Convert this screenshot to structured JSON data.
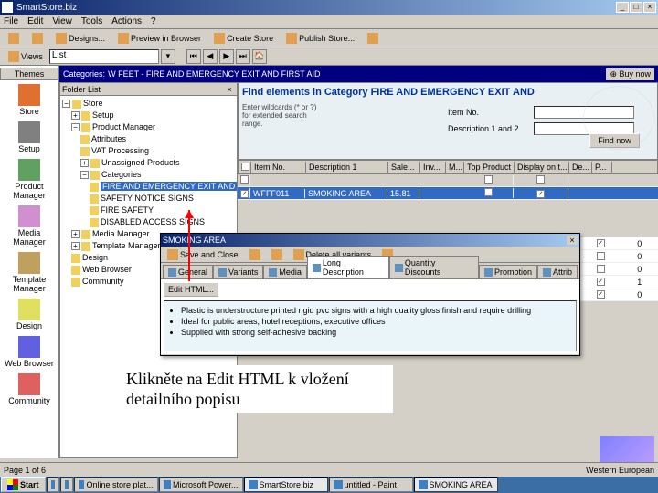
{
  "window": {
    "title": "SmartStore.biz"
  },
  "menu": {
    "file": "File",
    "edit": "Edit",
    "view": "View",
    "tools": "Tools",
    "actions": "Actions",
    "help": "?"
  },
  "toolbar1": {
    "designs": "Designs...",
    "preview": "Preview in Browser",
    "create": "Create Store",
    "publish": "Publish Store..."
  },
  "toolbar2": {
    "views": "Views",
    "dropdown": "List"
  },
  "sidebar": {
    "header": "Themes",
    "items": [
      {
        "label": "Store"
      },
      {
        "label": "Setup"
      },
      {
        "label": "Product Manager"
      },
      {
        "label": "Media Manager"
      },
      {
        "label": "Template Manager"
      },
      {
        "label": "Design"
      },
      {
        "label": "Web Browser"
      },
      {
        "label": "Community"
      }
    ]
  },
  "category": {
    "prefix": "Categories:",
    "name": "W FEET - FIRE AND EMERGENCY EXIT AND FIRST AID",
    "buy": "⊕ Buy now"
  },
  "folder": {
    "title": "Folder List",
    "root": "Store",
    "nodes": {
      "n1": "Setup",
      "n2": "Product Manager",
      "n3": "Attributes",
      "n4": "VAT Processing",
      "n5": "Unassigned Products",
      "n6": "Categories",
      "sel": "FIRE AND EMERGENCY EXIT AND FIRST AID",
      "n7": "SAFETY NOTICE SIGNS",
      "n8": "FIRE SAFETY",
      "n9": "DISABLED ACCESS SIGNS",
      "n10": "Media Manager",
      "n11": "Template Manager",
      "n12": "Design",
      "n13": "Web Browser",
      "n14": "Community"
    }
  },
  "find": {
    "title": "Find elements in Category FIRE AND EMERGENCY EXIT AND",
    "hint": "Enter wildcards (* or ?) for extended search range.",
    "f1": "Item No.",
    "f2": "Description 1 and 2",
    "btn": "Find now"
  },
  "grid": {
    "cols": {
      "c0": "",
      "c1": "Item No.",
      "c2": "Description 1",
      "c3": "Sale...",
      "c4": "Inv...",
      "c5": "M...",
      "c6": "Top Product ?",
      "c7": "Display on t...",
      "c8": "De...",
      "c9": "P..."
    },
    "row1": {
      "num": "WFFF011",
      "desc": "SMOKING AREA",
      "price": "15.81"
    }
  },
  "rightcol": {
    "r": [
      [
        "☑",
        "0"
      ],
      [
        "☐",
        "0"
      ],
      [
        "☐",
        "0"
      ],
      [
        "☑",
        "1"
      ],
      [
        "☑",
        "0"
      ]
    ]
  },
  "detail": {
    "title": "SMOKING AREA",
    "tool": {
      "save": "Save and Close",
      "delvar": "Delete all variants"
    },
    "tabs": {
      "t1": "General",
      "t2": "Variants",
      "t3": "Media",
      "t4": "Long Description",
      "t5": "Quantity Discounts",
      "t6": "Promotion",
      "t7": "Attrib"
    },
    "edit": "Edit HTML...",
    "bul": [
      "Plastic is understructure printed rigid pvc signs with a high quality gloss finish and require drilling",
      "Ideal for public areas, hotel receptions, executive offices",
      "Supplied with strong self-adhesive backing"
    ]
  },
  "annotation": "Klikněte na Edit HTML k vložení detailního popisu",
  "status": {
    "left": "Page 1 of 6",
    "right": "Western European"
  },
  "taskbar": {
    "start": "Start",
    "items": [
      "Online store plat...",
      "Microsoft Power...",
      "SmartStore.biz",
      "untitled - Paint",
      "SMOKING AREA"
    ]
  }
}
